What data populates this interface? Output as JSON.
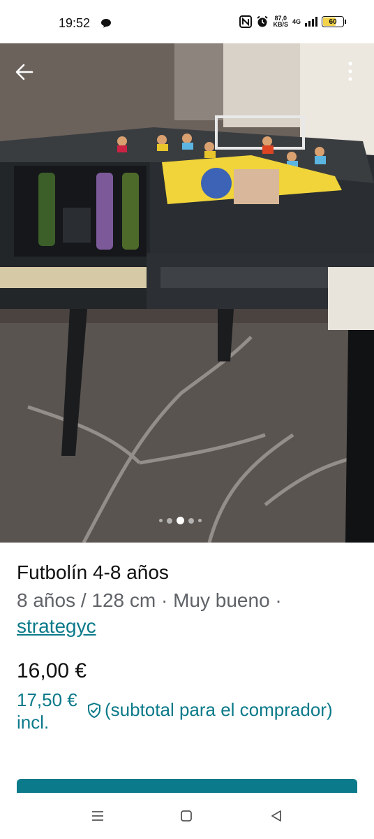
{
  "status_bar": {
    "time": "19:52",
    "speed_value": "87,0",
    "speed_unit": "KB/S",
    "network": "4G",
    "battery": "60"
  },
  "listing": {
    "title": "Futbolín 4-8 años",
    "details": "8 años / 128 cm · Muy bueno ·",
    "seller": "strategyc",
    "price": "16,00 €",
    "price_incl": "17,50 €",
    "price_incl_suffix": "incl.",
    "protection_text": "(subtotal para el comprador)"
  },
  "gallery": {
    "current_index": 3,
    "total": 5
  },
  "colors": {
    "accent": "#0b7a8a",
    "battery": "#f2d34a"
  },
  "icons": [
    "arrow-left-icon",
    "more-vertical-icon",
    "shield-check-icon",
    "menu-icon",
    "home-square-icon",
    "back-triangle-icon"
  ]
}
